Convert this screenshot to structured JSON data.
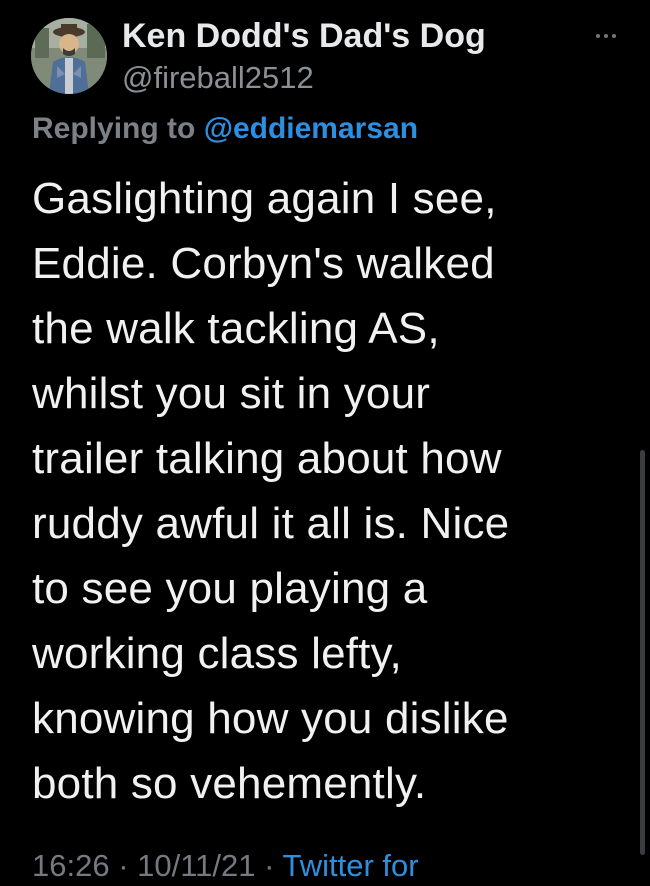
{
  "colors": {
    "background": "#000000",
    "primary_text": "#e7e9ea",
    "secondary_text": "#7c8187",
    "link": "#2d8fdf"
  },
  "author": {
    "display_name": "Ken Dodd's Dad's Dog",
    "handle": "@fireball2512",
    "avatar_icon": "user-avatar-photo"
  },
  "more_icon": "ellipsis-icon",
  "reply": {
    "prefix": "Replying to",
    "user": "@eddiemarsan"
  },
  "tweet": {
    "text": "Gaslighting again I see,\nEddie. Corbyn's walked\nthe walk tackling AS,\nwhilst you sit in your\ntrailer talking about how\nruddy awful it all is. Nice\nto see you playing a\nworking class lefty,\nknowing how you dislike\nboth so vehemently."
  },
  "meta": {
    "time": "16:26",
    "date": "10/11/21",
    "source": "Twitter for"
  }
}
